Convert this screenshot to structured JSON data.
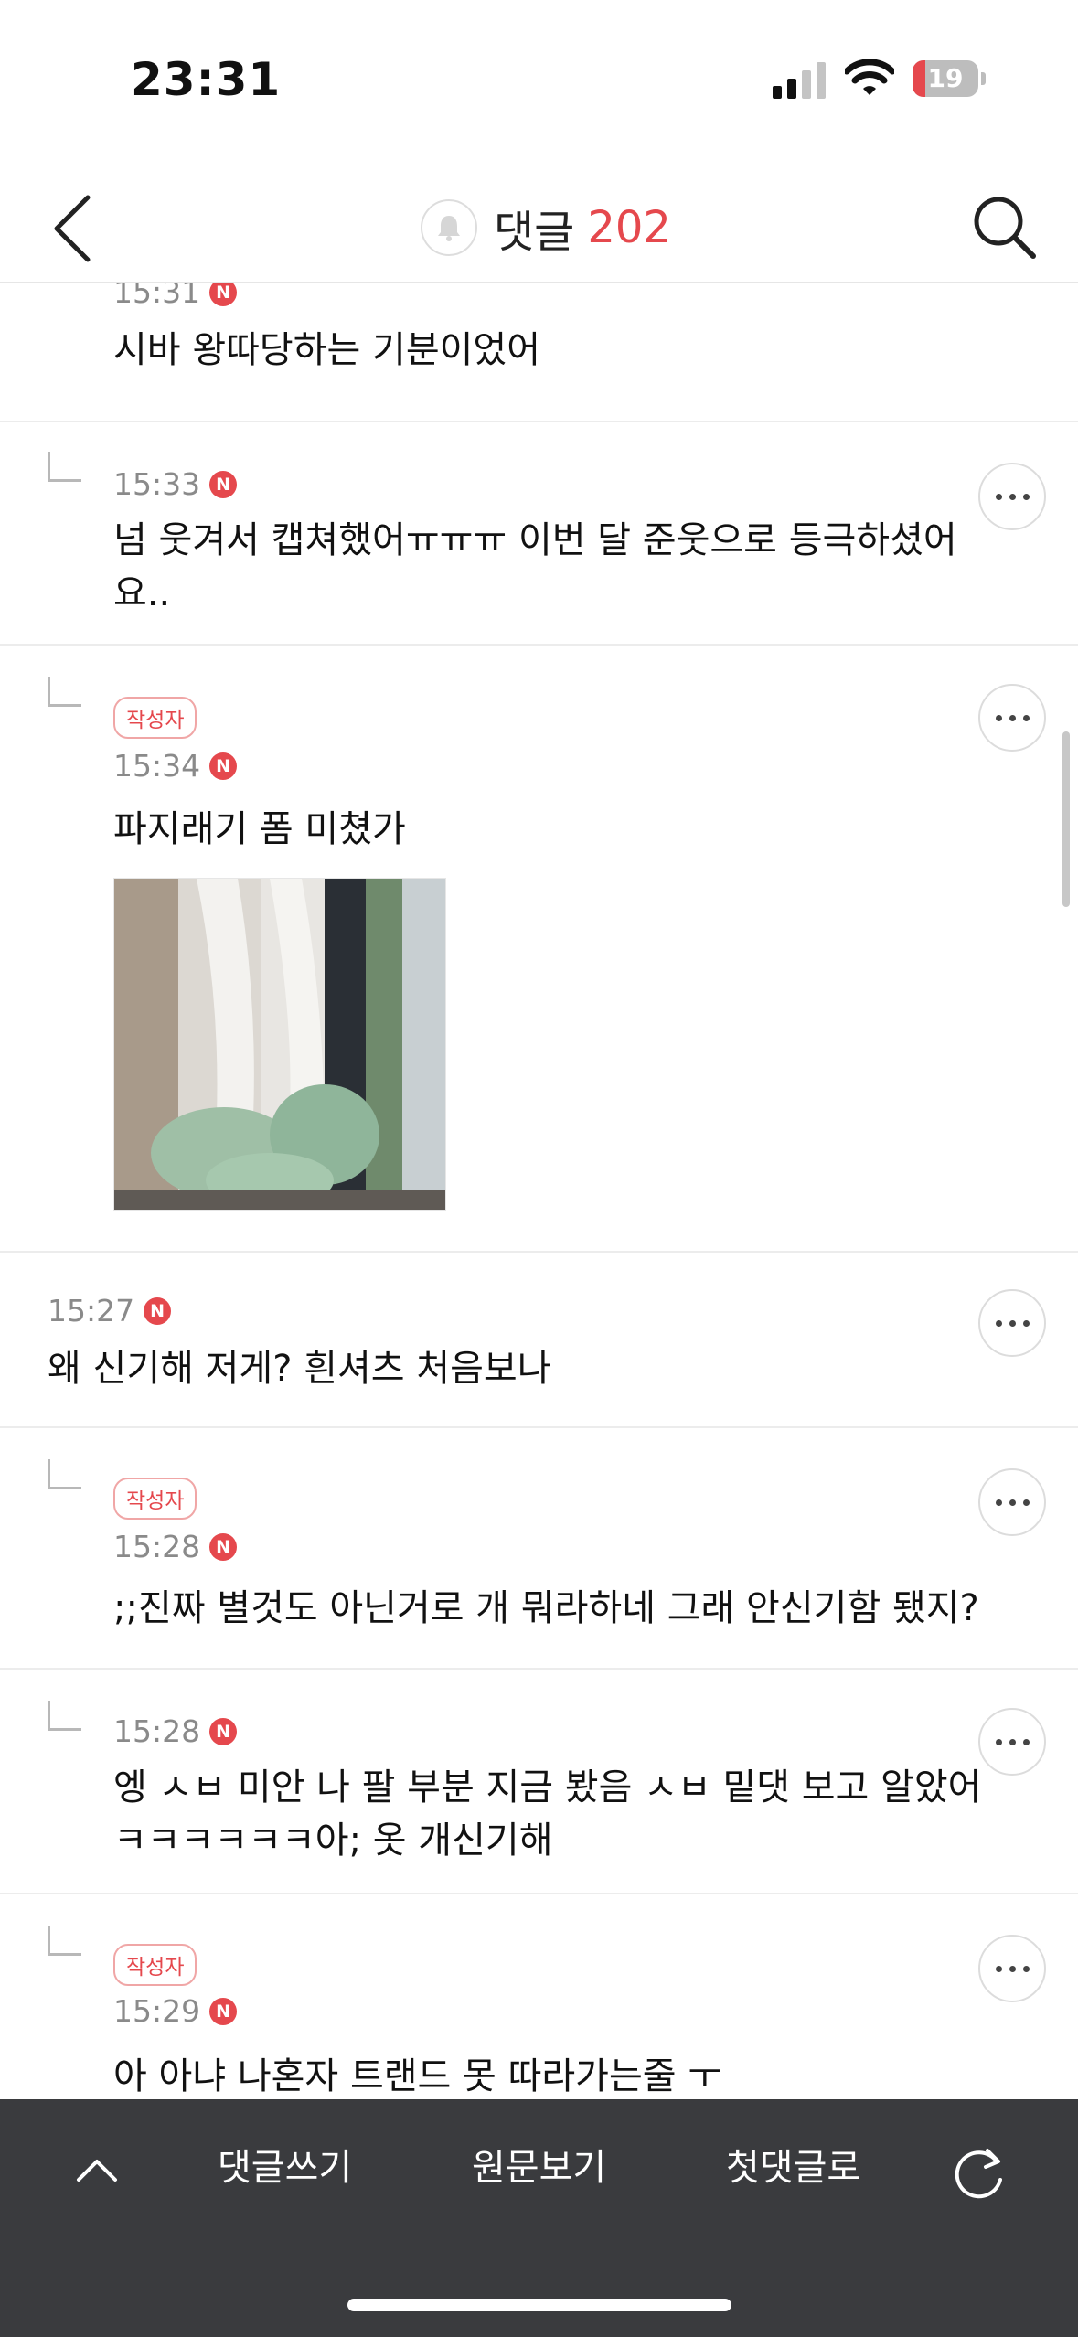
{
  "status_bar": {
    "time": "23:31",
    "battery_level": "19",
    "battery_fill_percent": 19
  },
  "nav": {
    "title": "댓글",
    "count": "202"
  },
  "comments": [
    {
      "time": "15:31",
      "badge": "N",
      "text": "시바 왕따당하는 기분이었어"
    },
    {
      "time": "15:33",
      "badge": "N",
      "text": "넘 웃겨서 캡쳐했어ㅠㅠㅠ 이번 달 준웃으로 등극하셨어요.."
    },
    {
      "author_tag": "작성자",
      "time": "15:34",
      "badge": "N",
      "text": "파지래기 폼 미쳤가"
    },
    {
      "time": "15:27",
      "badge": "N",
      "text": "왜 신기해 저게? 흰셔츠 처음보나"
    },
    {
      "author_tag": "작성자",
      "time": "15:28",
      "badge": "N",
      "text": ";;진짜 별것도 아닌거로 개 뭐라하네 그래 안신기함 됐지?"
    },
    {
      "time": "15:28",
      "badge": "N",
      "text": "엥 ㅅㅂ 미안 나 팔 부분 지금 봤음 ㅅㅂ 밑댓 보고 알았어 ㅋㅋㅋㅋㅋㅋ아; 옷 개신기해"
    },
    {
      "author_tag": "작성자",
      "time": "15:29",
      "badge": "N",
      "text": "아 아냐 나혼자 트랜드 못 따라가는줄 ㅜ"
    }
  ],
  "toolbar": {
    "write_label": "댓글쓰기",
    "original_label": "원문보기",
    "first_label": "첫댓글로"
  },
  "colors": {
    "accent": "#e5484d",
    "toolbar_bg": "#3a3b3e"
  },
  "icons": [
    "back-arrow-icon",
    "bell-icon",
    "search-icon",
    "more-icon",
    "chevron-up-icon",
    "refresh-icon"
  ]
}
